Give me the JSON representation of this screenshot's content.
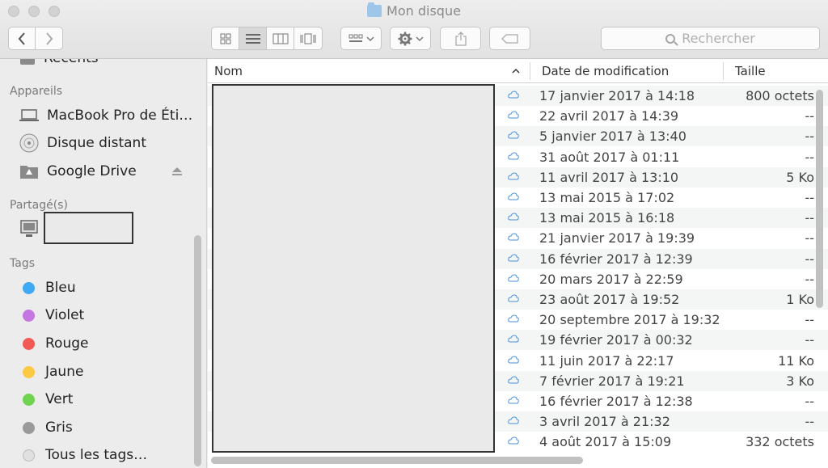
{
  "window": {
    "title": "Mon disque"
  },
  "toolbar": {
    "back_icon": "chevron-left-icon",
    "forward_icon": "chevron-right-icon",
    "view_modes": [
      "icon-view-icon",
      "list-view-icon",
      "column-view-icon",
      "coverflow-view-icon"
    ],
    "active_view": "list-view-icon",
    "search_placeholder": "Rechercher"
  },
  "sidebar": {
    "recents_label": "Récents",
    "devices_header": "Appareils",
    "devices": [
      {
        "label": "MacBook Pro de Éti…",
        "icon": "laptop-icon"
      },
      {
        "label": "Disque distant",
        "icon": "disc-icon"
      },
      {
        "label": "Google Drive",
        "icon": "google-drive-icon"
      }
    ],
    "shared_header": "Partagé(s)",
    "tags_header": "Tags",
    "tags": [
      {
        "label": "Bleu",
        "color": "#3fa9f5"
      },
      {
        "label": "Violet",
        "color": "#c477e0"
      },
      {
        "label": "Rouge",
        "color": "#f25b55"
      },
      {
        "label": "Jaune",
        "color": "#fbc943"
      },
      {
        "label": "Vert",
        "color": "#6fd34f"
      },
      {
        "label": "Gris",
        "color": "#9a9a9a"
      },
      {
        "label": "Tous les tags…",
        "color": "#e0e0e0"
      }
    ]
  },
  "list": {
    "columns": {
      "name": "Nom",
      "date": "Date de modification",
      "size": "Taille"
    },
    "rows": [
      {
        "date": "17 janvier 2017 à 14:18",
        "size": "800 octets"
      },
      {
        "date": "22 avril 2017 à 14:39",
        "size": "--"
      },
      {
        "date": "5 janvier 2017 à 13:40",
        "size": "--"
      },
      {
        "date": "31 août 2017 à 01:11",
        "size": "--"
      },
      {
        "date": "11 avril 2017 à 13:10",
        "size": "5 Ko"
      },
      {
        "date": "13 mai 2015 à 17:02",
        "size": "--"
      },
      {
        "date": "13 mai 2015 à 16:18",
        "size": "--"
      },
      {
        "date": "21 janvier 2017 à 19:39",
        "size": "--"
      },
      {
        "date": "16 février 2017 à 12:39",
        "size": "--"
      },
      {
        "date": "20 mars 2017 à 22:59",
        "size": "--"
      },
      {
        "date": "23 août 2017 à 19:52",
        "size": "1 Ko"
      },
      {
        "date": "20 septembre 2017 à 19:32",
        "size": "--"
      },
      {
        "date": "19 février 2017 à 00:32",
        "size": "--"
      },
      {
        "date": "11 juin 2017 à 22:17",
        "size": "11 Ko"
      },
      {
        "date": "7 février 2017 à 19:21",
        "size": "3 Ko"
      },
      {
        "date": "16 février 2017 à 12:38",
        "size": "--"
      },
      {
        "date": "3 avril 2017 à 21:32",
        "size": "--"
      },
      {
        "date": "4 août 2017 à 15:09",
        "size": "332 octets"
      }
    ]
  }
}
